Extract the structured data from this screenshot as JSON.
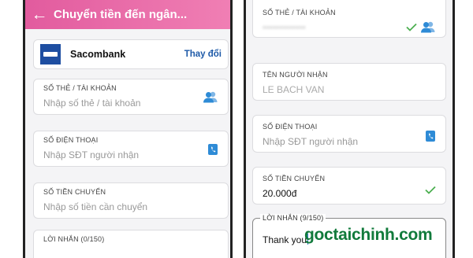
{
  "left_screen": {
    "header": {
      "back_icon": "arrow-left-icon",
      "title": "Chuyển tiền đến ngân..."
    },
    "bank": {
      "logo_icon": "sacombank-logo-icon",
      "name": "Sacombank",
      "change_label": "Thay đổi"
    },
    "account_field": {
      "label": "SỐ THẺ / TÀI KHOẢN",
      "placeholder": "Nhập số thẻ / tài khoản",
      "icon": "contacts-icon"
    },
    "phone_field": {
      "label": "SỐ ĐIỆN THOẠI",
      "placeholder": "Nhập SĐT người nhận",
      "icon": "phonebook-icon"
    },
    "amount_field": {
      "label": "SỐ TIỀN CHUYỂN",
      "placeholder": "Nhập số tiền cần chuyển"
    },
    "message_field": {
      "label": "LỜI NHẮN (0/150)"
    }
  },
  "right_screen": {
    "account_field": {
      "label": "SỐ THẺ / TÀI KHOẢN",
      "value": "•••••••••••••",
      "check_icon": "check-icon",
      "icon": "contacts-icon"
    },
    "recipient_field": {
      "label": "TÊN NGƯỜI NHẬN",
      "value": "LE BACH VAN"
    },
    "phone_field": {
      "label": "SỐ ĐIỆN THOẠI",
      "placeholder": "Nhập SĐT người nhận",
      "icon": "phonebook-icon"
    },
    "amount_field": {
      "label": "SỐ TIỀN CHUYỂN",
      "value": "20.000đ",
      "check_icon": "check-icon"
    },
    "message_field": {
      "label": "LỜI NHẮN (9/150)",
      "value": "Thank you"
    }
  },
  "watermark": "goctaichinh.com",
  "colors": {
    "header_pink": "#e8609f",
    "link_blue": "#1e5aa8",
    "icon_blue": "#2e8bd6",
    "check_green": "#4caf50",
    "watermark_green": "#117a3b"
  }
}
